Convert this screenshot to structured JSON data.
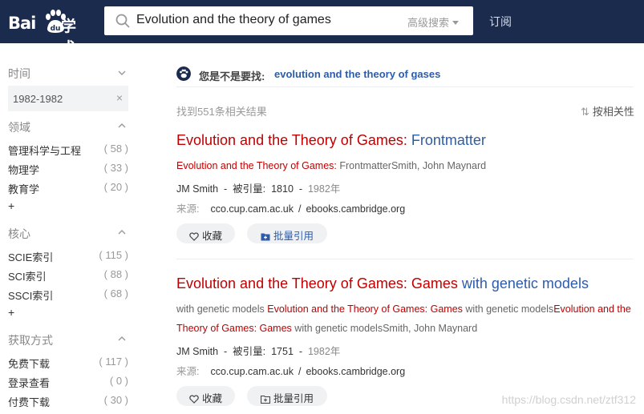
{
  "header": {
    "logo_text": "Bai",
    "logo_paw_text": "du",
    "logo_suffix": "学术",
    "search_query": "Evolution and the theory of games",
    "advanced_search": "高级搜索",
    "subscribe": "订阅"
  },
  "sidebar": {
    "time": {
      "title": "时间",
      "tag": "1982-1982",
      "clear": "×"
    },
    "field": {
      "title": "领域",
      "items": [
        {
          "label": "管理科学与工程",
          "count": "( 58 )"
        },
        {
          "label": "物理学",
          "count": "( 33 )"
        },
        {
          "label": "教育学",
          "count": "( 20 )"
        }
      ],
      "more": "+"
    },
    "core": {
      "title": "核心",
      "items": [
        {
          "label": "SCIE索引",
          "count": "( 115 )"
        },
        {
          "label": "SCI索引",
          "count": "( 88 )"
        },
        {
          "label": "SSCI索引",
          "count": "( 68 )"
        }
      ],
      "more": "+"
    },
    "access": {
      "title": "获取方式",
      "items": [
        {
          "label": "免费下载",
          "count": "( 117 )"
        },
        {
          "label": "登录查看",
          "count": "( 0 )"
        },
        {
          "label": "付费下载",
          "count": "( 30 )"
        }
      ]
    }
  },
  "main": {
    "did_you_mean_label": "您是不是要找:",
    "did_you_mean_suggestion": "evolution and the theory of gases",
    "found": "找到551条相关结果",
    "sort": "按相关性",
    "results": [
      {
        "title_red": "Evolution and the Theory of Games:",
        "title_blue": " Frontmatter",
        "abstract_red": "Evolution and the Theory of Games:",
        "abstract_rest": " FrontmatterSmith, John Maynard",
        "author": "JM Smith",
        "cited_label": "被引量:",
        "cited": "1810",
        "year": "1982年",
        "source_label": "来源:",
        "source1": "cco.cup.cam.ac.uk",
        "source2": "ebooks.cambridge.org",
        "collect": "收藏",
        "cite": "批量引用"
      },
      {
        "title_red": "Evolution and the Theory of Games: Games",
        "title_blue": " with genetic models",
        "abstract_p1": "with genetic models ",
        "abstract_r1": "Evolution and the Theory of Games: Games",
        "abstract_p2": " with genetic models",
        "abstract_r2": "Evolution and the Theory of Games: Games",
        "abstract_p3": " with genetic modelsSmith, John Maynard",
        "author": "JM Smith",
        "cited_label": "被引量:",
        "cited": "1751",
        "year": "1982年",
        "source_label": "来源:",
        "source1": "cco.cup.cam.ac.uk",
        "source2": "ebooks.cambridge.org",
        "collect": "收藏",
        "cite": "批量引用"
      }
    ],
    "watermark": "https://blog.csdn.net/ztf312"
  }
}
